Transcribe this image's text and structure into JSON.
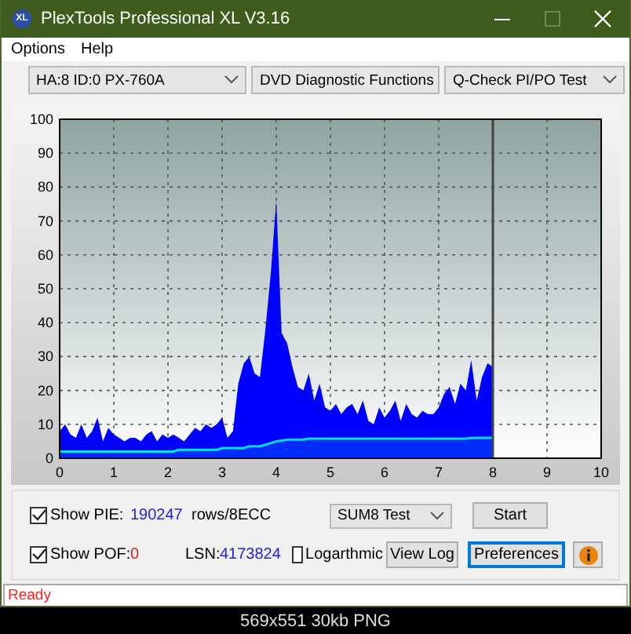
{
  "window": {
    "icon_label": "XL",
    "title": "PlexTools Professional XL V3.16"
  },
  "menu": [
    {
      "label": "Options"
    },
    {
      "label": "Help"
    }
  ],
  "toolbar": [
    {
      "value": "HA:8 ID:0  PX-760A"
    },
    {
      "value": "DVD Diagnostic Functions"
    },
    {
      "value": "Q-Check PI/PO Test"
    }
  ],
  "chart_data": {
    "type": "area",
    "grid": true,
    "ref_lines": [
      {
        "axis": "x",
        "value": 8
      }
    ],
    "xlim": [
      0,
      10
    ],
    "ylim": [
      0,
      100
    ],
    "xticks": [
      0,
      1,
      2,
      3,
      4,
      5,
      6,
      7,
      8,
      9,
      10
    ],
    "yticks": [
      0,
      10,
      20,
      30,
      40,
      50,
      60,
      70,
      80,
      90,
      100
    ],
    "x": [
      0,
      0.1,
      0.2,
      0.3,
      0.4,
      0.5,
      0.6,
      0.7,
      0.8,
      0.9,
      1,
      1.1,
      1.2,
      1.3,
      1.4,
      1.5,
      1.6,
      1.7,
      1.8,
      1.9,
      2,
      2.1,
      2.2,
      2.3,
      2.4,
      2.5,
      2.6,
      2.7,
      2.8,
      2.9,
      3,
      3.1,
      3.2,
      3.3,
      3.4,
      3.5,
      3.6,
      3.7,
      3.8,
      3.9,
      4,
      4.1,
      4.2,
      4.3,
      4.4,
      4.5,
      4.6,
      4.7,
      4.8,
      4.9,
      5,
      5.1,
      5.2,
      5.3,
      5.4,
      5.5,
      5.6,
      5.7,
      5.8,
      5.9,
      6,
      6.1,
      6.2,
      6.3,
      6.4,
      6.5,
      6.6,
      6.7,
      6.8,
      6.9,
      7,
      7.1,
      7.2,
      7.3,
      7.4,
      7.5,
      7.6,
      7.7,
      7.8,
      7.9,
      8
    ],
    "series": [
      {
        "color": "#0000ff",
        "values": [
          8,
          10,
          7,
          6,
          10,
          6,
          8,
          12,
          5,
          9,
          7,
          6,
          5,
          6,
          6,
          5,
          7,
          8,
          5,
          7,
          6,
          7,
          6,
          5,
          7,
          9,
          8,
          10,
          9,
          10,
          12,
          6,
          8,
          22,
          28,
          30,
          25,
          24,
          38,
          55,
          76,
          37,
          34,
          27,
          21,
          20,
          25,
          17,
          22,
          15,
          14,
          16,
          13,
          15,
          16,
          13,
          17,
          11,
          10,
          15,
          12,
          14,
          17,
          11,
          16,
          13,
          12,
          14,
          13,
          13,
          15,
          19,
          21,
          16,
          22,
          20,
          29,
          17,
          24,
          28,
          27
        ]
      },
      {
        "color": "#00e0f0",
        "values": [
          2,
          2,
          2,
          2,
          2,
          2,
          2,
          2,
          2,
          2,
          2,
          2,
          2,
          2,
          2,
          2,
          2,
          2,
          2,
          2,
          2,
          2,
          2.5,
          2.5,
          2.5,
          2.5,
          2.5,
          2.5,
          2.5,
          2.5,
          3,
          3,
          3,
          3,
          3,
          3.5,
          3.5,
          3.5,
          4,
          4.5,
          5,
          5.2,
          5.5,
          5.5,
          5.5,
          5.5,
          5.8,
          5.8,
          5.8,
          5.8,
          5.8,
          5.8,
          5.8,
          5.8,
          5.8,
          5.8,
          5.8,
          5.8,
          5.8,
          5.8,
          5.8,
          5.8,
          5.8,
          5.8,
          5.8,
          5.8,
          5.8,
          5.8,
          5.8,
          5.8,
          5.8,
          5.8,
          5.8,
          5.8,
          5.8,
          5.8,
          6,
          6,
          6,
          6,
          6
        ]
      }
    ]
  },
  "controls": {
    "show_pie": {
      "label": "Show PIE:",
      "checked": true
    },
    "pie_value": "190247",
    "unit": "rows/8ECC",
    "test_select": {
      "value": "SUM8 Test"
    },
    "show_pof": {
      "label": "Show POF:",
      "checked": true
    },
    "pof_value": "0",
    "lsn_label": "LSN:",
    "lsn_value": "4173824",
    "logarithmic": {
      "label": "Logarthmic",
      "checked": false
    },
    "buttons": [
      {
        "label": "Start",
        "focused": false
      },
      {
        "label": "View Log",
        "focused": false
      },
      {
        "label": "Preferences",
        "focused": true
      }
    ]
  },
  "status_bar": "Ready",
  "caption": "569x551 30kb PNG"
}
